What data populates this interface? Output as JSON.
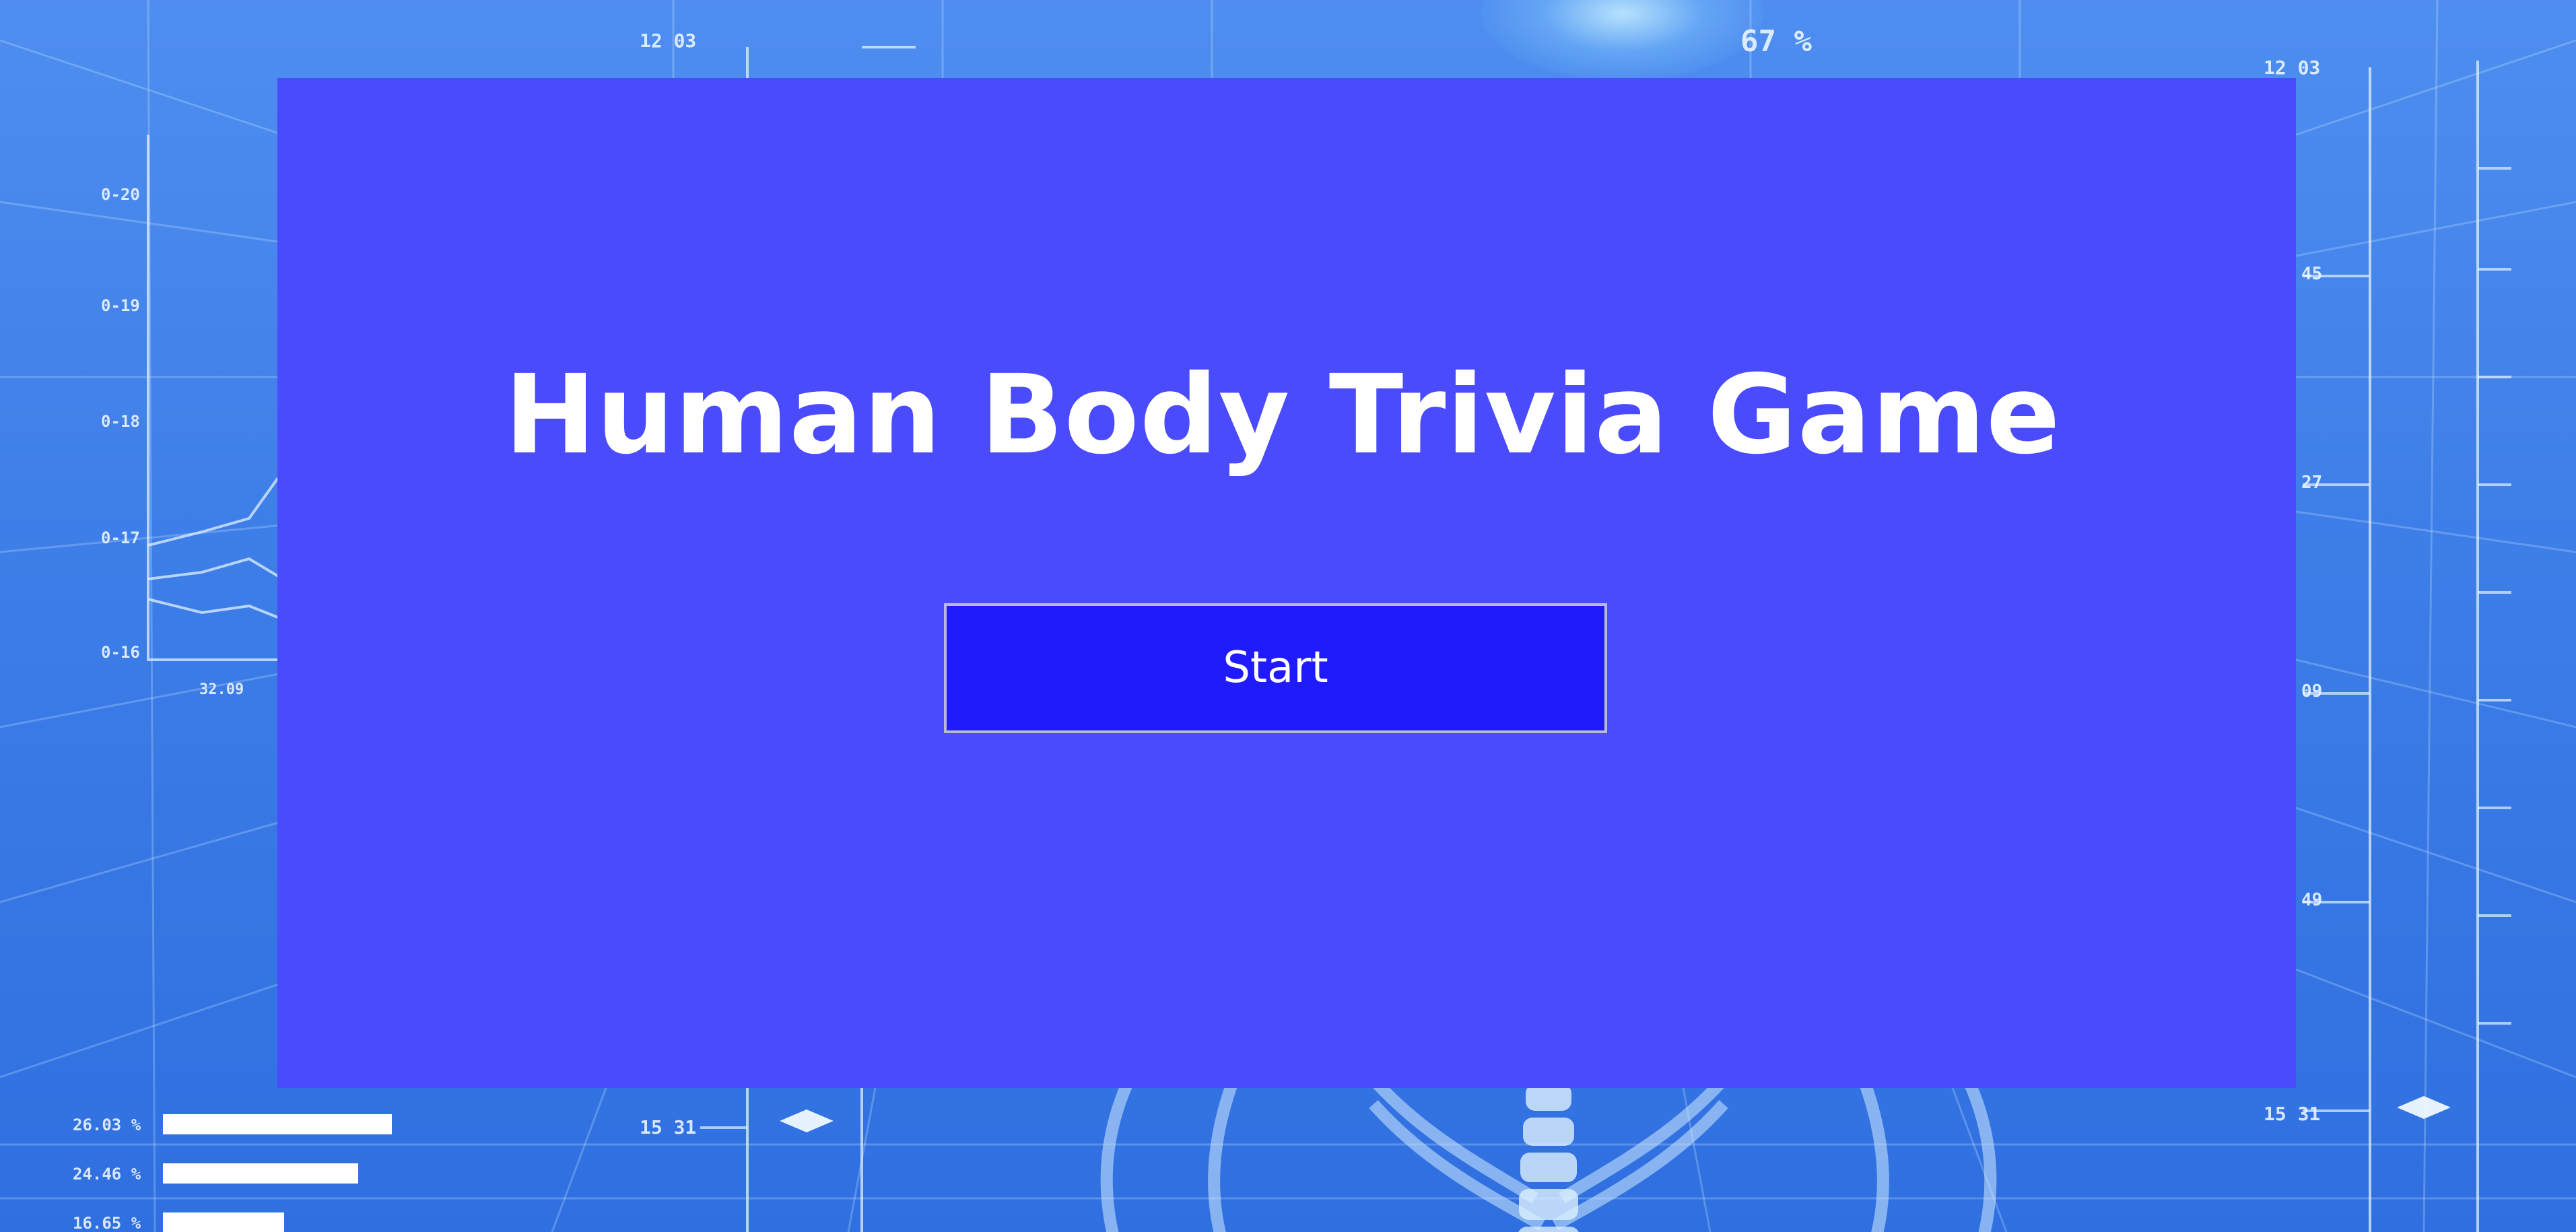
{
  "app": {
    "title": "Human Body Trivia Game"
  },
  "menu": {
    "start_label": "Start"
  },
  "background": {
    "hud_percent": "67 %",
    "hud_top_left": "12 03",
    "hud_top_right": "12 03",
    "hud_bottom_left": "15 31",
    "hud_bottom_right": "15 31",
    "scale_labels": [
      "45",
      "27",
      "09",
      "49"
    ],
    "axis_labels": [
      "0-20",
      "0-19",
      "0-18",
      "0-17",
      "0-16"
    ],
    "axis_x_label": "32.09",
    "bar_labels": [
      "26.03 %",
      "24.46 %",
      "16.65 %"
    ],
    "bar_values": [
      0.34,
      0.29,
      0.18
    ]
  },
  "colors": {
    "panel": "#4a4bfc",
    "button": "#1f1bfc",
    "background": "#3f7fe8"
  }
}
